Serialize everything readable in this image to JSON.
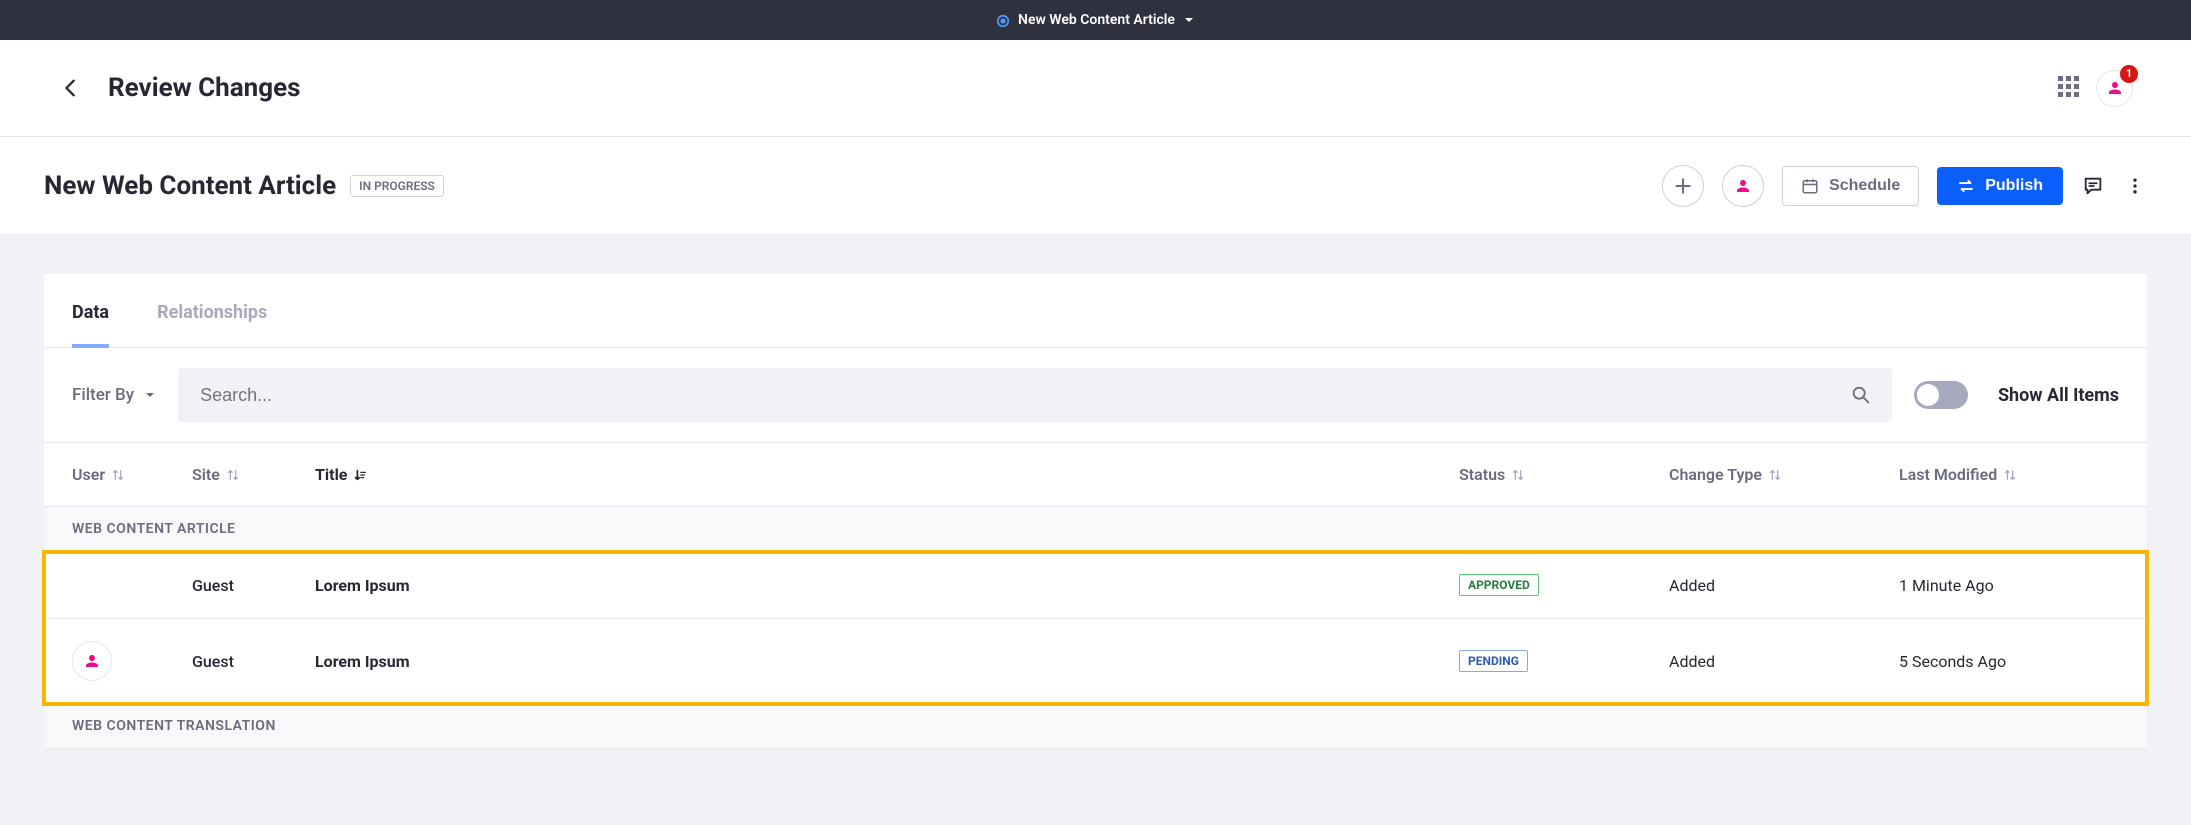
{
  "topbar": {
    "title": "New Web Content Article"
  },
  "header": {
    "title": "Review Changes",
    "notif_count": "1"
  },
  "subheader": {
    "article_title": "New Web Content Article",
    "status": "IN PROGRESS",
    "schedule_label": "Schedule",
    "publish_label": "Publish"
  },
  "tabs": [
    {
      "label": "Data",
      "active": true
    },
    {
      "label": "Relationships",
      "active": false
    }
  ],
  "filter": {
    "filter_by_label": "Filter By",
    "search_placeholder": "Search...",
    "show_all_label": "Show All Items"
  },
  "columns": {
    "user": "User",
    "site": "Site",
    "title": "Title",
    "status": "Status",
    "change_type": "Change Type",
    "last_modified": "Last Modified"
  },
  "groups": [
    {
      "name": "WEB CONTENT ARTICLE",
      "highlighted": true,
      "rows": [
        {
          "has_avatar": false,
          "site": "Guest",
          "title": "Lorem Ipsum",
          "status": "APPROVED",
          "status_class": "status-approved",
          "change_type": "Added",
          "last_modified": "1 Minute Ago"
        },
        {
          "has_avatar": true,
          "site": "Guest",
          "title": "Lorem Ipsum",
          "status": "PENDING",
          "status_class": "status-pending",
          "change_type": "Added",
          "last_modified": "5 Seconds Ago"
        }
      ]
    },
    {
      "name": "WEB CONTENT TRANSLATION",
      "highlighted": false,
      "rows": []
    }
  ],
  "colors": {
    "accent": "#ec0d8f",
    "primary": "#0b5fff"
  }
}
